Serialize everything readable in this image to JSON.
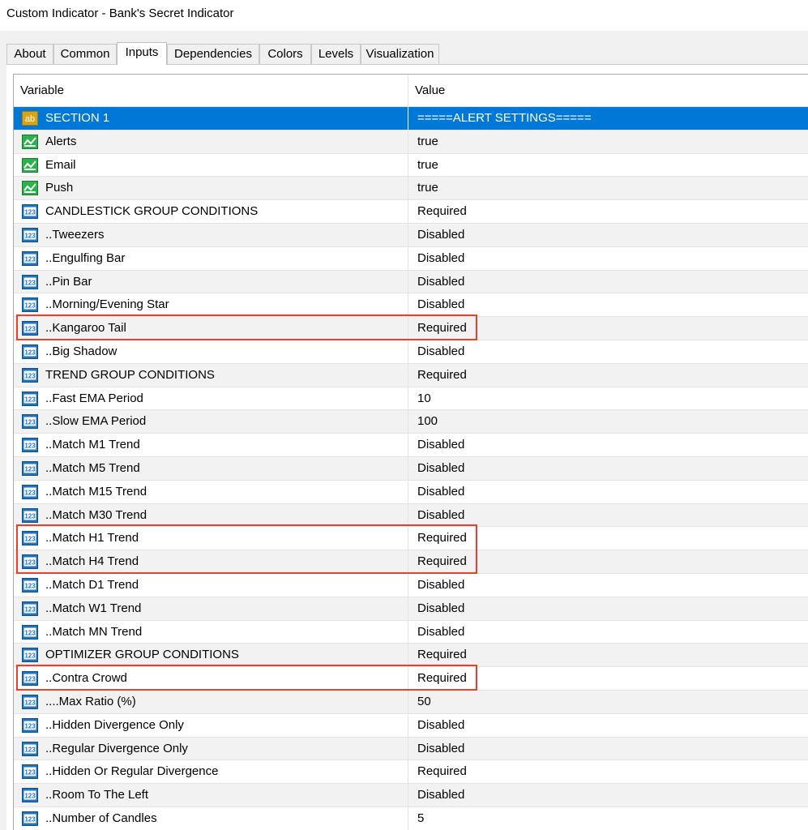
{
  "window": {
    "title": "Custom Indicator - Bank's Secret Indicator"
  },
  "tabs": [
    {
      "label": "About",
      "active": false
    },
    {
      "label": "Common",
      "active": false
    },
    {
      "label": "Inputs",
      "active": true
    },
    {
      "label": "Dependencies",
      "active": false
    },
    {
      "label": "Colors",
      "active": false
    },
    {
      "label": "Levels",
      "active": false
    },
    {
      "label": "Visualization",
      "active": false
    }
  ],
  "grid": {
    "columns": {
      "variable": "Variable",
      "value": "Value"
    },
    "rows": [
      {
        "variable": "SECTION 1",
        "value": "=====ALERT SETTINGS=====",
        "icon": "string-type-icon",
        "selected": true
      },
      {
        "variable": "Alerts",
        "value": "true",
        "icon": "bool-type-icon"
      },
      {
        "variable": "Email",
        "value": "true",
        "icon": "bool-type-icon"
      },
      {
        "variable": "Push",
        "value": "true",
        "icon": "bool-type-icon"
      },
      {
        "variable": "CANDLESTICK GROUP CONDITIONS",
        "value": "Required",
        "icon": "enum-type-icon"
      },
      {
        "variable": "..Tweezers",
        "value": "Disabled",
        "icon": "enum-type-icon"
      },
      {
        "variable": "..Engulfing Bar",
        "value": "Disabled",
        "icon": "enum-type-icon"
      },
      {
        "variable": "..Pin Bar",
        "value": "Disabled",
        "icon": "enum-type-icon"
      },
      {
        "variable": "..Morning/Evening Star",
        "value": "Disabled",
        "icon": "enum-type-icon"
      },
      {
        "variable": "..Kangaroo Tail",
        "value": "Required",
        "icon": "enum-type-icon"
      },
      {
        "variable": "..Big Shadow",
        "value": "Disabled",
        "icon": "enum-type-icon"
      },
      {
        "variable": "TREND GROUP CONDITIONS",
        "value": "Required",
        "icon": "enum-type-icon"
      },
      {
        "variable": "..Fast EMA Period",
        "value": "10",
        "icon": "enum-type-icon"
      },
      {
        "variable": "..Slow EMA Period",
        "value": "100",
        "icon": "enum-type-icon"
      },
      {
        "variable": "..Match M1 Trend",
        "value": "Disabled",
        "icon": "enum-type-icon"
      },
      {
        "variable": "..Match M5 Trend",
        "value": "Disabled",
        "icon": "enum-type-icon"
      },
      {
        "variable": "..Match M15 Trend",
        "value": "Disabled",
        "icon": "enum-type-icon"
      },
      {
        "variable": "..Match M30 Trend",
        "value": "Disabled",
        "icon": "enum-type-icon"
      },
      {
        "variable": "..Match H1 Trend",
        "value": "Required",
        "icon": "enum-type-icon"
      },
      {
        "variable": "..Match H4 Trend",
        "value": "Required",
        "icon": "enum-type-icon"
      },
      {
        "variable": "..Match D1 Trend",
        "value": "Disabled",
        "icon": "enum-type-icon"
      },
      {
        "variable": "..Match W1 Trend",
        "value": "Disabled",
        "icon": "enum-type-icon"
      },
      {
        "variable": "..Match MN Trend",
        "value": "Disabled",
        "icon": "enum-type-icon"
      },
      {
        "variable": "OPTIMIZER GROUP CONDITIONS",
        "value": "Required",
        "icon": "enum-type-icon"
      },
      {
        "variable": "..Contra Crowd",
        "value": "Required",
        "icon": "enum-type-icon"
      },
      {
        "variable": "....Max Ratio (%)",
        "value": "50",
        "icon": "enum-type-icon"
      },
      {
        "variable": "..Hidden Divergence Only",
        "value": "Disabled",
        "icon": "enum-type-icon"
      },
      {
        "variable": "..Regular Divergence Only",
        "value": "Disabled",
        "icon": "enum-type-icon"
      },
      {
        "variable": "..Hidden Or Regular Divergence",
        "value": "Required",
        "icon": "enum-type-icon"
      },
      {
        "variable": "..Room To The Left",
        "value": "Disabled",
        "icon": "enum-type-icon"
      },
      {
        "variable": "..Number of Candles",
        "value": "5",
        "icon": "enum-type-icon"
      }
    ]
  },
  "highlights": [
    {
      "from_row": 9,
      "to_row": 9
    },
    {
      "from_row": 18,
      "to_row": 19
    },
    {
      "from_row": 24,
      "to_row": 24
    }
  ],
  "colors": {
    "selection": "#0078d7",
    "highlight_box": "#e8402a",
    "enum_icon": "#1e73be",
    "bool_icon": "#2bb24c",
    "string_icon": "#d9a515"
  },
  "icon_glyphs": {
    "string-type-icon": "ab",
    "enum-type-icon": "123"
  }
}
